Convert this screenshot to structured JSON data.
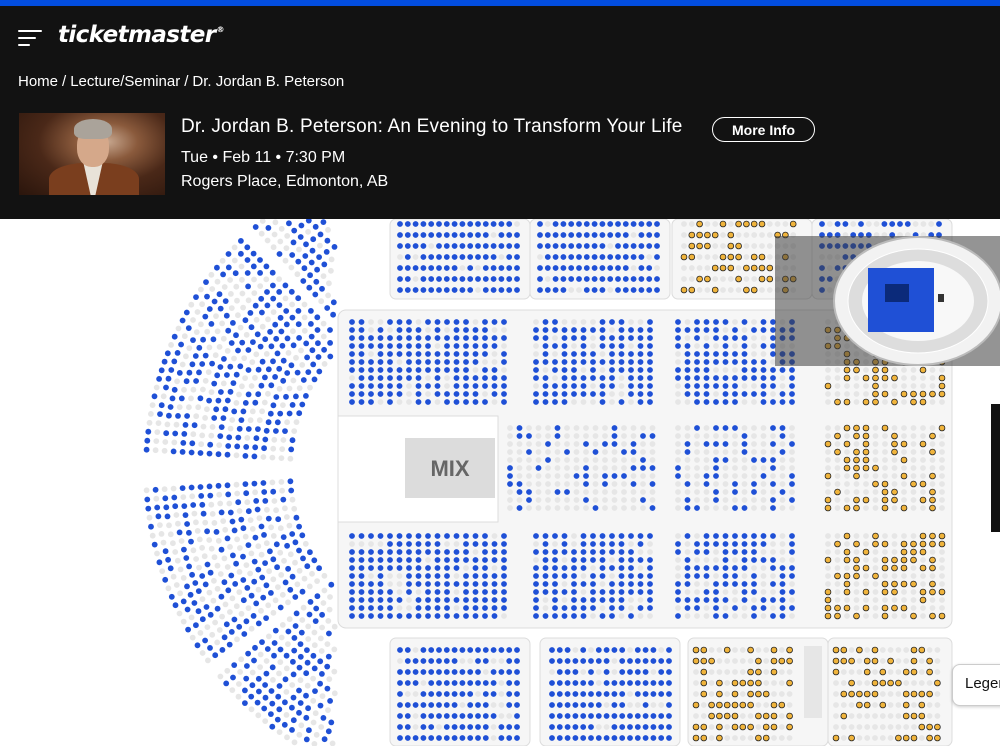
{
  "brand": {
    "logo": "ticketmaster",
    "registered": "®",
    "accent": "#024ddf"
  },
  "breadcrumb": [
    "Home",
    "Lecture/Seminar",
    "Dr. Jordan B. Peterson"
  ],
  "event": {
    "title": "Dr. Jordan B. Peterson: An Evening to Transform Your Life",
    "date": "Tue • Feb 11 • 7:30 PM",
    "venue": "Rogers Place, Edmonton, AB",
    "more_info": "More Info"
  },
  "seatmap": {
    "mix_label": "MIX",
    "colors": {
      "available": "#1f50d6",
      "resale": "#f0b43c",
      "unavailable": "#e6e6e6"
    }
  },
  "legend": {
    "label": "Legend"
  }
}
